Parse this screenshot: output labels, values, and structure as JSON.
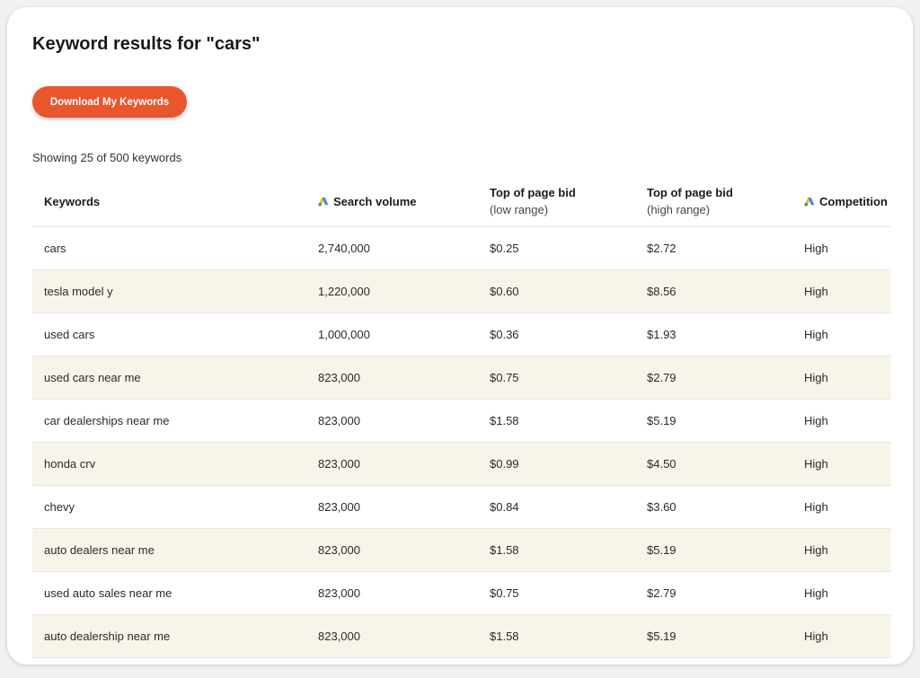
{
  "page": {
    "title": "Keyword results for \"cars\"",
    "download_label": "Download My Keywords",
    "showing_text": "Showing 25 of 500 keywords"
  },
  "colors": {
    "accent": "#e8562e",
    "alt_row": "#f7f5ea",
    "google_ads_blue": "#4285f4",
    "google_ads_yellow": "#fbbc04",
    "google_ads_green": "#34a853"
  },
  "table": {
    "headers": {
      "keywords": "Keywords",
      "search_volume": "Search volume",
      "low_bid_title": "Top of page bid",
      "low_bid_sub": "(low range)",
      "high_bid_title": "Top of page bid",
      "high_bid_sub": "(high range)",
      "competition": "Competition"
    },
    "header_icon": "google-ads-icon",
    "rows": [
      {
        "keyword": "cars",
        "volume": "2,740,000",
        "low": "$0.25",
        "high": "$2.72",
        "competition": "High"
      },
      {
        "keyword": "tesla model y",
        "volume": "1,220,000",
        "low": "$0.60",
        "high": "$8.56",
        "competition": "High"
      },
      {
        "keyword": "used cars",
        "volume": "1,000,000",
        "low": "$0.36",
        "high": "$1.93",
        "competition": "High"
      },
      {
        "keyword": "used cars near me",
        "volume": "823,000",
        "low": "$0.75",
        "high": "$2.79",
        "competition": "High"
      },
      {
        "keyword": "car dealerships near me",
        "volume": "823,000",
        "low": "$1.58",
        "high": "$5.19",
        "competition": "High"
      },
      {
        "keyword": "honda crv",
        "volume": "823,000",
        "low": "$0.99",
        "high": "$4.50",
        "competition": "High"
      },
      {
        "keyword": "chevy",
        "volume": "823,000",
        "low": "$0.84",
        "high": "$3.60",
        "competition": "High"
      },
      {
        "keyword": "auto dealers near me",
        "volume": "823,000",
        "low": "$1.58",
        "high": "$5.19",
        "competition": "High"
      },
      {
        "keyword": "used auto sales near me",
        "volume": "823,000",
        "low": "$0.75",
        "high": "$2.79",
        "competition": "High"
      },
      {
        "keyword": "auto dealership near me",
        "volume": "823,000",
        "low": "$1.58",
        "high": "$5.19",
        "competition": "High"
      }
    ]
  }
}
